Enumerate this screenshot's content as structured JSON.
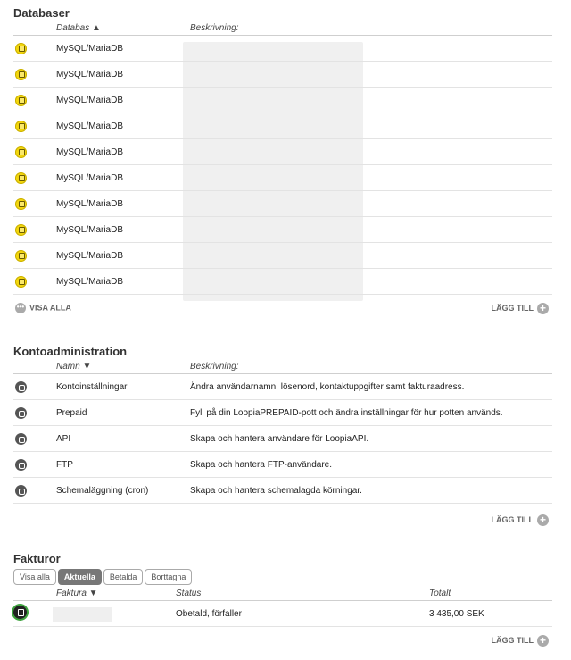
{
  "databases": {
    "title": "Databaser",
    "col_db": "Databas ▲",
    "col_desc": "Beskrivning:",
    "rows": [
      {
        "name": "MySQL/MariaDB",
        "icon": "database-icon"
      },
      {
        "name": "MySQL/MariaDB",
        "icon": "database-icon"
      },
      {
        "name": "MySQL/MariaDB",
        "icon": "database-icon"
      },
      {
        "name": "MySQL/MariaDB",
        "icon": "database-icon"
      },
      {
        "name": "MySQL/MariaDB",
        "icon": "database-icon"
      },
      {
        "name": "MySQL/MariaDB",
        "icon": "database-icon"
      },
      {
        "name": "MySQL/MariaDB",
        "icon": "database-icon"
      },
      {
        "name": "MySQL/MariaDB",
        "icon": "database-icon"
      },
      {
        "name": "MySQL/MariaDB",
        "icon": "database-icon"
      },
      {
        "name": "MySQL/MariaDB",
        "icon": "database-icon"
      }
    ],
    "show_all": "VISA ALLA",
    "add": "LÄGG TILL"
  },
  "account": {
    "title": "Kontoadministration",
    "col_name": "Namn ▼",
    "col_desc": "Beskrivning:",
    "rows": [
      {
        "name": "Kontoinställningar",
        "desc": "Ändra användarnamn, lösenord, kontaktuppgifter samt fakturaadress.",
        "icon": "gear-icon"
      },
      {
        "name": "Prepaid",
        "desc": "Fyll på din LoopiaPREPAID-pott och ändra inställningar för hur potten används.",
        "icon": "wallet-icon"
      },
      {
        "name": "API",
        "desc": "Skapa och hantera användare för LoopiaAPI.",
        "icon": "api-icon"
      },
      {
        "name": "FTP",
        "desc": "Skapa och hantera FTP-användare.",
        "icon": "folder-icon"
      },
      {
        "name": "Schemaläggning (cron)",
        "desc": "Skapa och hantera schemalagda körningar.",
        "icon": "clock-icon"
      }
    ],
    "add": "LÄGG TILL"
  },
  "invoices": {
    "title": "Fakturor",
    "filters": [
      "Visa alla",
      "Aktuella",
      "Betalda",
      "Borttagna"
    ],
    "active_filter": "Aktuella",
    "col_invoice": "Faktura ▼",
    "col_status": "Status",
    "col_total": "Totalt",
    "rows": [
      {
        "status": "Obetald, förfaller",
        "total": "3 435,00 SEK",
        "icon": "invoice-icon"
      }
    ],
    "add": "LÄGG TILL"
  },
  "colors": {
    "db_icon": "#f3d60e",
    "icon_dark": "#555555",
    "invoice_ring": "#3fa33f",
    "active_filter": "#777777"
  }
}
